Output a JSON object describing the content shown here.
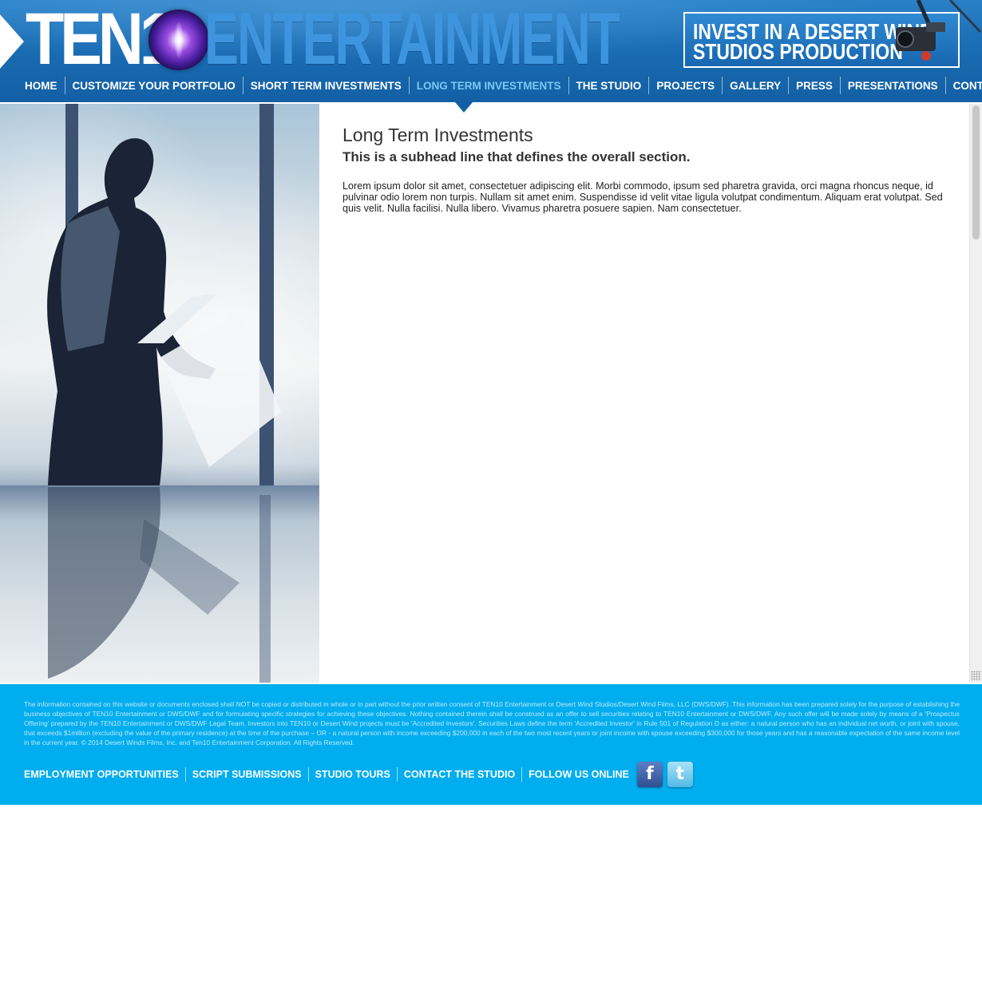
{
  "brand": {
    "logo_part1": "TEN1",
    "logo_part2": "ENTERTAINMENT",
    "logo_text": "TEN10 ENTERTAINMENT",
    "colors": {
      "header_blue": "#1a6db4",
      "footer_blue": "#00adee",
      "active_nav": "#7cc8f6",
      "logo_blue": "#3f95dd"
    }
  },
  "banner": {
    "line1": "INVEST IN A DESERT WIND",
    "line2": "STUDIOS PRODUCTION",
    "icon": "film-camera-icon"
  },
  "nav": {
    "items": [
      {
        "label": "HOME",
        "active": false
      },
      {
        "label": "CUSTOMIZE YOUR PORTFOLIO",
        "active": false
      },
      {
        "label": "SHORT TERM INVESTMENTS",
        "active": false
      },
      {
        "label": "LONG TERM INVESTMENTS",
        "active": true
      },
      {
        "label": "THE STUDIO",
        "active": false
      },
      {
        "label": "PROJECTS",
        "active": false
      },
      {
        "label": "GALLERY",
        "active": false
      },
      {
        "label": "PRESS",
        "active": false
      },
      {
        "label": "PRESENTATIONS",
        "active": false
      },
      {
        "label": "CONTACT",
        "active": false
      }
    ]
  },
  "main": {
    "title": "Long Term Investments",
    "subhead": "This is a subhead line that defines the overall section.",
    "body": "Lorem ipsum dolor sit amet, consectetuer adipiscing elit. Morbi commodo, ipsum sed pharetra gravida, orci magna rhoncus neque, id pulvinar odio lorem non turpis. Nullam sit amet enim. Suspendisse id velit vitae ligula volutpat condimentum. Aliquam erat volutpat. Sed quis velit. Nulla facilisi. Nulla libero. Vivamus pharetra posuere sapien. Nam consectetuer."
  },
  "footer": {
    "disclaimer": "The information contained on this website or documents enclosed shall NOT be copied or distributed in whole or in part without the prior written consent of TEN10 Entertainment or Desert Wind Studios/Desert Wind Films, LLC (DWS/DWF).  This information has been prepared solely for the purpose of establishing the business objectives of TEN10 Entertainment or DWS/DWF and for formulating specific strategies for achieving these objectives. Nothing contained therein shall be construed as an offer to sell securities relating to TEN10 Entertainment or DWS/DWF.  Any such offer will be made solely by means of a 'Prospectus Offering' prepared by the TEN10 Entertainment or DWS/DWF Legal Team. Investors into TEN10 or Desert Wind projects must be 'Accredited Investors'. Securities Laws define the term 'Accredited Investor' in Rule 501 of Regulation D as either: a natural person who has an individual net worth, or joint with spouse, that exceeds $1million (excluding the value of the primary residence) at the time of the purchase – OR - a natural person with income exceeding $200,000 in each of the two most recent years or joint income with spouse exceeding $300,000 for those years and has a reasonable expectation of the same income level in the current year.    © 2014 Desert Winds Films, Inc. and Ten10 Entertainment Corporation. All Rights Reserved.",
    "links": [
      {
        "label": "EMPLOYMENT OPPORTUNITIES"
      },
      {
        "label": "SCRIPT SUBMISSIONS"
      },
      {
        "label": "STUDIO TOURS"
      },
      {
        "label": "CONTACT THE STUDIO"
      }
    ],
    "follow_label": "FOLLOW US ONLINE",
    "social": [
      {
        "name": "facebook-icon",
        "glyph": "f"
      },
      {
        "name": "twitter-icon",
        "glyph": "t"
      }
    ]
  }
}
